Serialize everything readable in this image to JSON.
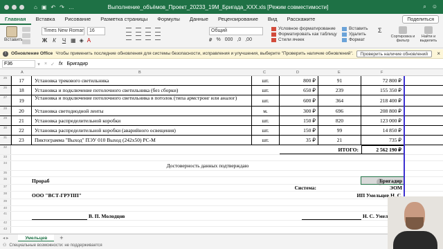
{
  "window": {
    "title": "Выполнение_объёмов_Проект_20233_19М_Бригада_XXX.xls [Режим совместимости]"
  },
  "ribbon_tabs": [
    "Главная",
    "Вставка",
    "Рисование",
    "Разметка страницы",
    "Формулы",
    "Данные",
    "Рецензирование",
    "Вид",
    "Расскажите"
  ],
  "share_label": "Поделиться",
  "ribbon": {
    "paste": "Вставить",
    "font_name": "Times New Roman",
    "font_size": "16",
    "number_format": "Общий",
    "cond_format": "Условное форматирование",
    "format_table": "Форматировать как таблицу",
    "cell_styles": "Стили ячеек",
    "insert": "Вставить",
    "delete": "Удалить",
    "format": "Формат",
    "sort_filter": "Сортировка и фильтр",
    "find_select": "Найти и выделить"
  },
  "notification": {
    "title": "Обновление Office",
    "message": "Чтобы применить последние обновления для системы безопасности, исправления и улучшения, выберите \"Проверить наличие обновлений\".",
    "button": "Проверить наличие обновлений"
  },
  "formula_bar": {
    "cell_ref": "F36",
    "content": "Бригадир"
  },
  "columns": [
    "A",
    "B",
    "C",
    "D",
    "E",
    "F"
  ],
  "rows": [
    {
      "rn": "25",
      "num": "17",
      "name": "Установка трекового светильника",
      "unit": "шт.",
      "price": "800 ₽",
      "qty": "91",
      "sum": "72 800 ₽"
    },
    {
      "rn": "26",
      "num": "18",
      "name": "Установка и подключение потолочного светильника (без сборки)",
      "unit": "шт.",
      "price": "650 ₽",
      "qty": "239",
      "sum": "155 350 ₽"
    },
    {
      "rn": "27",
      "num": "19",
      "name": "Установка и подключение потолочного светильника в потолок (типа армстронг или аналог)",
      "unit": "шт.",
      "price": "600 ₽",
      "qty": "364",
      "sum": "218 400 ₽"
    },
    {
      "rn": "28",
      "num": "20",
      "name": "Установка светодиодной ленты",
      "unit": "м.",
      "price": "300 ₽",
      "qty": "696",
      "sum": "208 800 ₽"
    },
    {
      "rn": "29",
      "num": "21",
      "name": "Установка распределительной коробки",
      "unit": "шт.",
      "price": "150 ₽",
      "qty": "820",
      "sum": "123 000 ₽"
    },
    {
      "rn": "30",
      "num": "22",
      "name": "Установка распределительной коробки (аварийного освещения)",
      "unit": "шт.",
      "price": "150 ₽",
      "qty": "99",
      "sum": "14 850 ₽"
    },
    {
      "rn": "31",
      "num": "23",
      "name": "Пиктограмма \"Выход\" ПЭУ 010 Выход (242х50) РС-М",
      "unit": "шт.",
      "price": "35 ₽",
      "qty": "21",
      "sum": "735 ₽"
    }
  ],
  "total": {
    "rn": "32",
    "label": "ИТОГО:",
    "value": "2 562 190 ₽"
  },
  "footer": {
    "rn_blank1": "33",
    "rn_confirm": "34",
    "confirm": "Достоверность данных подтверждаю",
    "rn_blank2": "35",
    "rn_roles": "36",
    "left_role": "Прораб",
    "right_role": "Бригадир",
    "rn_eom": "37",
    "system_label": "Система:",
    "system_value": "ЭОМ",
    "rn_company": "38",
    "left_company": "ООО \"ВСТ-ГРУПП\"",
    "right_company": "ИП Умельцев Н. С.",
    "rn_blank3": "39",
    "rn_blank4": "40",
    "rn_sign": "41",
    "left_sign": "В. П. Молодцов",
    "right_sign": "Н. С. Умельцев",
    "rn_blank5": "42",
    "rn_blank6": "43"
  },
  "sheet_tab": "Умельцев",
  "status": "Специальные возможности: не поддерживается"
}
